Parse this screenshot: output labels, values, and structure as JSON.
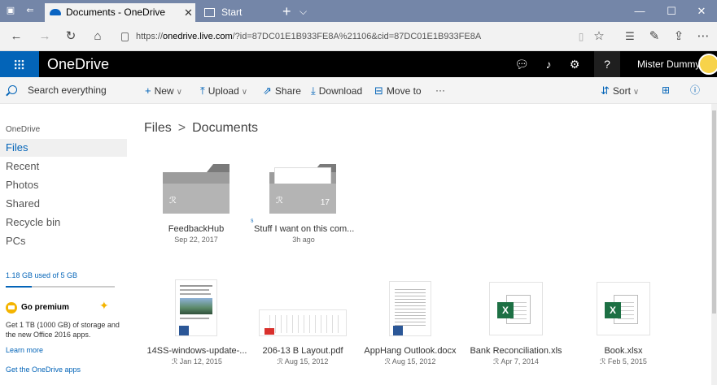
{
  "browser": {
    "tab_active_title": "Documents - OneDrive",
    "tab_inactive_title": "Start",
    "new_tab": "+",
    "url_prefix": "https://",
    "url_host": "onedrive.live.com",
    "url_rest": "/?id=87DC01E1B933FE8A%21106&cid=87DC01E1B933FE8A"
  },
  "header": {
    "app_name": "OneDrive",
    "user_name": "Mister Dummy"
  },
  "search": {
    "placeholder": "Search everything"
  },
  "commands": {
    "new": "New",
    "upload": "Upload",
    "share": "Share",
    "download": "Download",
    "move_to": "Move to",
    "more": "···",
    "sort": "Sort"
  },
  "leftnav": {
    "heading": "OneDrive",
    "items": [
      "Files",
      "Recent",
      "Photos",
      "Shared",
      "Recycle bin",
      "PCs"
    ],
    "storage_text": "1.18 GB used of 5 GB",
    "storage_fraction": 0.236,
    "premium_title": "Go premium",
    "premium_desc": "Get 1 TB (1000 GB) of storage and the new Office 2016 apps.",
    "learn_more": "Learn more",
    "get_apps": "Get the OneDrive apps"
  },
  "breadcrumb": {
    "root": "Files",
    "current": "Documents"
  },
  "folders": [
    {
      "name": "FeedbackHub",
      "date": "Sep 22, 2017",
      "count": ""
    },
    {
      "name": "Stuff I want on this com...",
      "date": "3h ago",
      "count": "17"
    }
  ],
  "files": [
    {
      "name": "14SS-windows-update-...",
      "date": "Jan 12, 2015"
    },
    {
      "name": "206-13 B Layout.pdf",
      "date": "Aug 15, 2012"
    },
    {
      "name": "AppHang Outlook.docx",
      "date": "Aug 15, 2012"
    },
    {
      "name": "Bank Reconciliation.xls",
      "date": "Apr 7, 2014"
    },
    {
      "name": "Book.xlsx",
      "date": "Feb 5, 2015"
    }
  ],
  "icons": {
    "shared": "ℛ",
    "excel_letter": "X"
  }
}
